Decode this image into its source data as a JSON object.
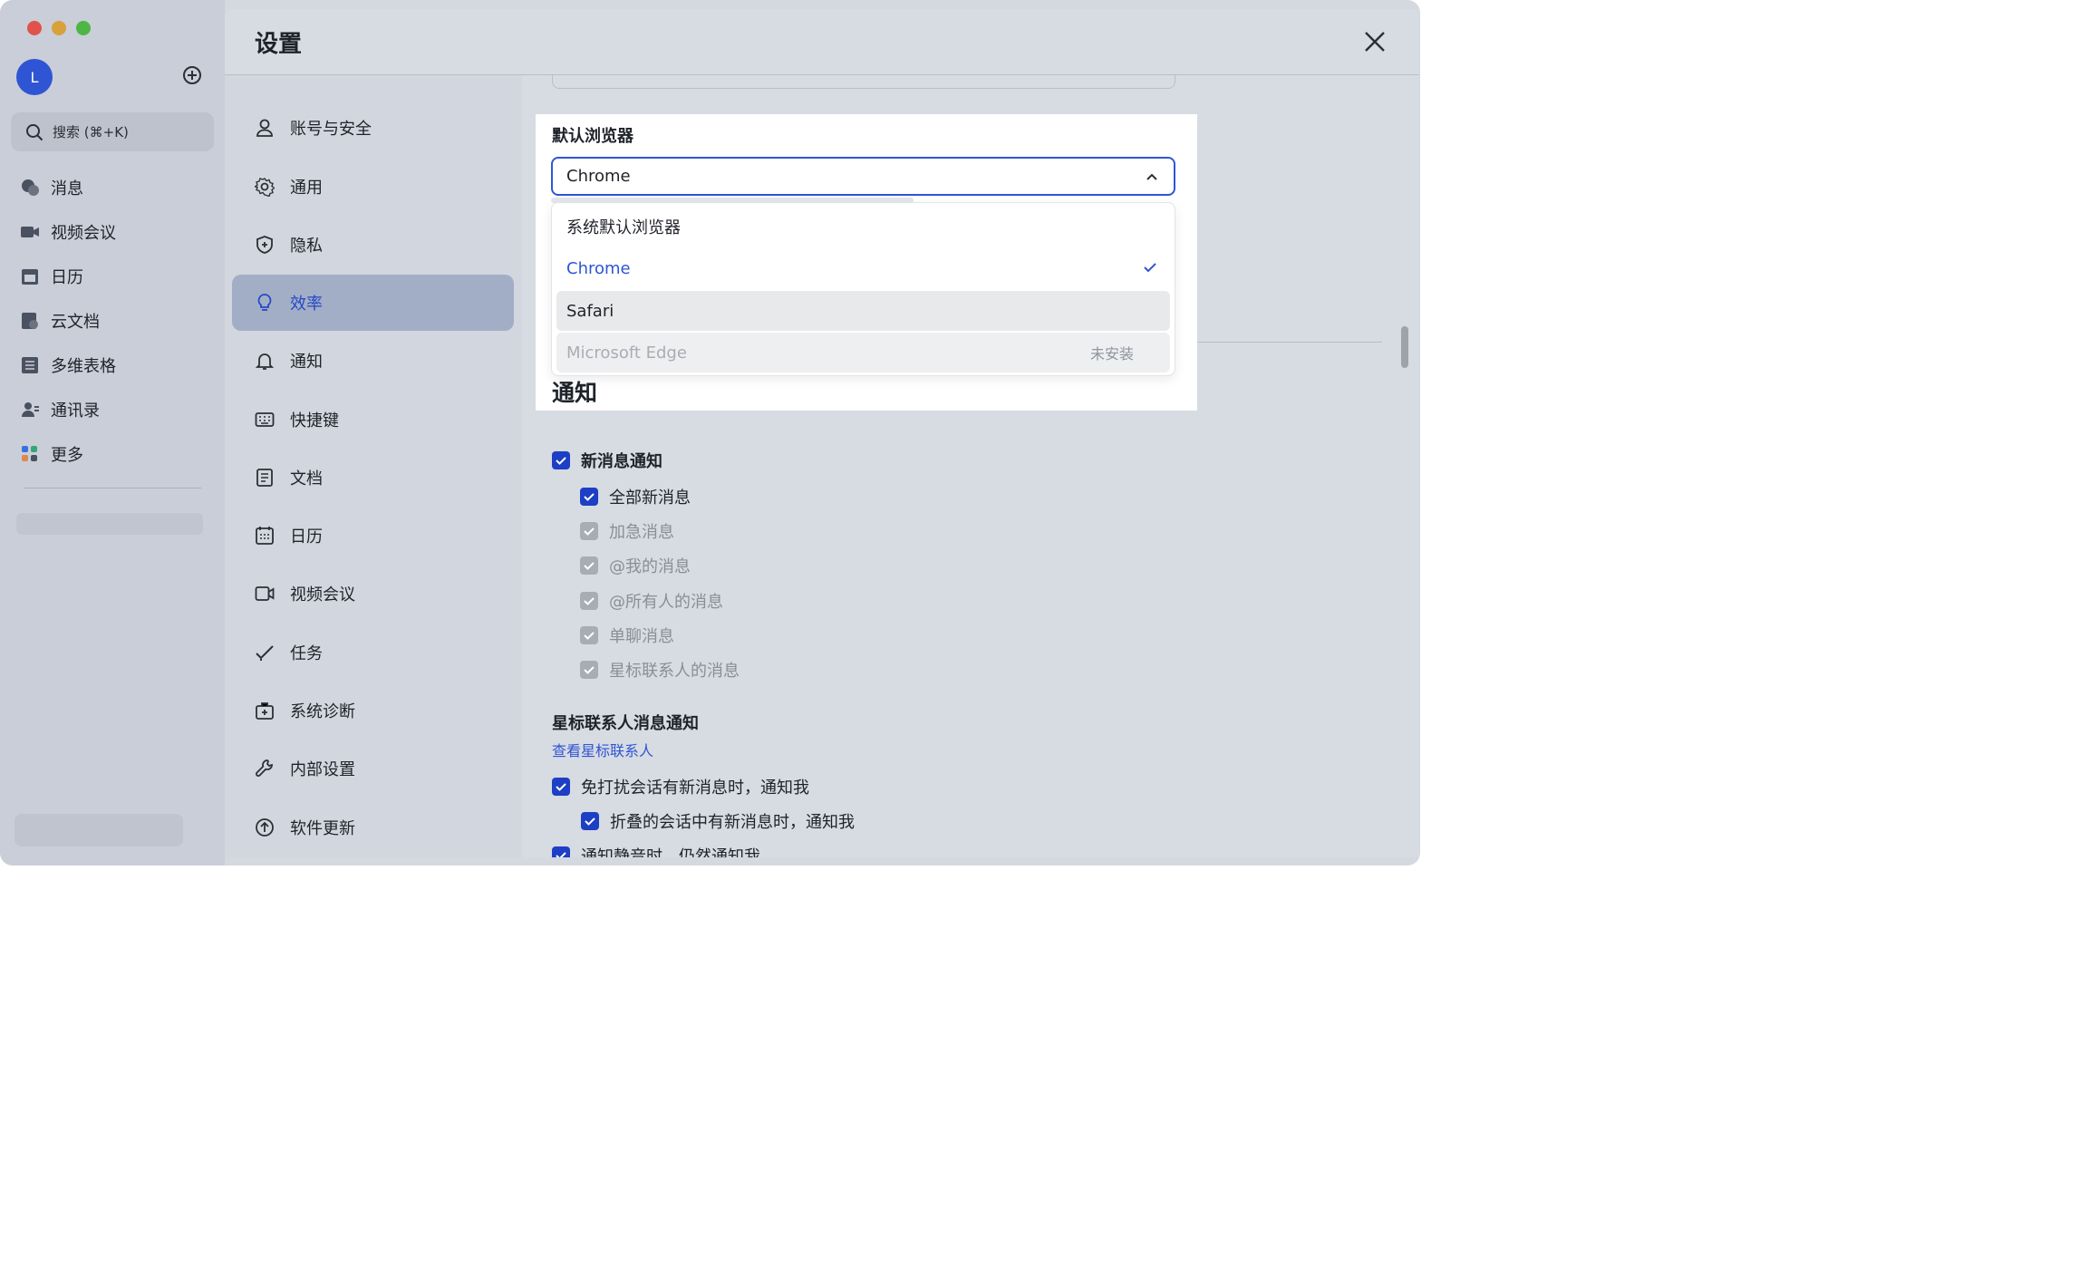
{
  "window": {
    "title": "设置"
  },
  "app_sidebar": {
    "avatar_initial": "L",
    "search_placeholder": "搜索 (⌘+K)",
    "items": [
      {
        "label": "消息",
        "icon": "chat-bubble-icon"
      },
      {
        "label": "视频会议",
        "icon": "video-camera-icon"
      },
      {
        "label": "日历",
        "icon": "calendar-icon"
      },
      {
        "label": "云文档",
        "icon": "cloud-doc-icon"
      },
      {
        "label": "多维表格",
        "icon": "table-icon"
      },
      {
        "label": "通讯录",
        "icon": "contacts-icon"
      },
      {
        "label": "更多",
        "icon": "apps-grid-icon"
      }
    ]
  },
  "settings_nav": {
    "items": [
      {
        "label": "账号与安全",
        "icon": "user-icon"
      },
      {
        "label": "通用",
        "icon": "gear-icon"
      },
      {
        "label": "隐私",
        "icon": "shield-icon"
      },
      {
        "label": "效率",
        "icon": "lightbulb-icon",
        "active": true
      },
      {
        "label": "通知",
        "icon": "bell-icon"
      },
      {
        "label": "快捷键",
        "icon": "keyboard-icon"
      },
      {
        "label": "文档",
        "icon": "document-icon"
      },
      {
        "label": "日历",
        "icon": "calendar-icon"
      },
      {
        "label": "视频会议",
        "icon": "video-camera-icon"
      },
      {
        "label": "任务",
        "icon": "task-check-icon"
      },
      {
        "label": "系统诊断",
        "icon": "medical-kit-icon"
      },
      {
        "label": "内部设置",
        "icon": "wrench-icon"
      },
      {
        "label": "软件更新",
        "icon": "upload-arrow-icon"
      }
    ]
  },
  "default_browser": {
    "label": "默认浏览器",
    "selected_value": "Chrome",
    "options": [
      {
        "label": "系统默认浏览器"
      },
      {
        "label": "Chrome",
        "selected": true
      },
      {
        "label": "Safari",
        "hover": true
      },
      {
        "label": "Microsoft Edge",
        "disabled": true,
        "tag": "未安装"
      }
    ]
  },
  "notifications": {
    "title": "通知",
    "new_message": {
      "label": "新消息通知",
      "checked": true
    },
    "sub_options": [
      {
        "label": "全部新消息",
        "checked": true,
        "disabled": false
      },
      {
        "label": "加急消息",
        "checked": true,
        "disabled": true
      },
      {
        "label": "@我的消息",
        "checked": true,
        "disabled": true
      },
      {
        "label": "@所有人的消息",
        "checked": true,
        "disabled": true
      },
      {
        "label": "单聊消息",
        "checked": true,
        "disabled": true
      },
      {
        "label": "星标联系人的消息",
        "checked": true,
        "disabled": true
      }
    ],
    "starred_heading": "星标联系人消息通知",
    "starred_link": "查看星标联系人",
    "dnd_option": "免打扰会话有新消息时，通知我",
    "folded_option": "折叠的会话中有新消息时，通知我",
    "mute_option": "通知静音时，仍然通知我"
  },
  "colors": {
    "accent": "#2f55d4",
    "active_nav_bg": "#a2aec6"
  }
}
